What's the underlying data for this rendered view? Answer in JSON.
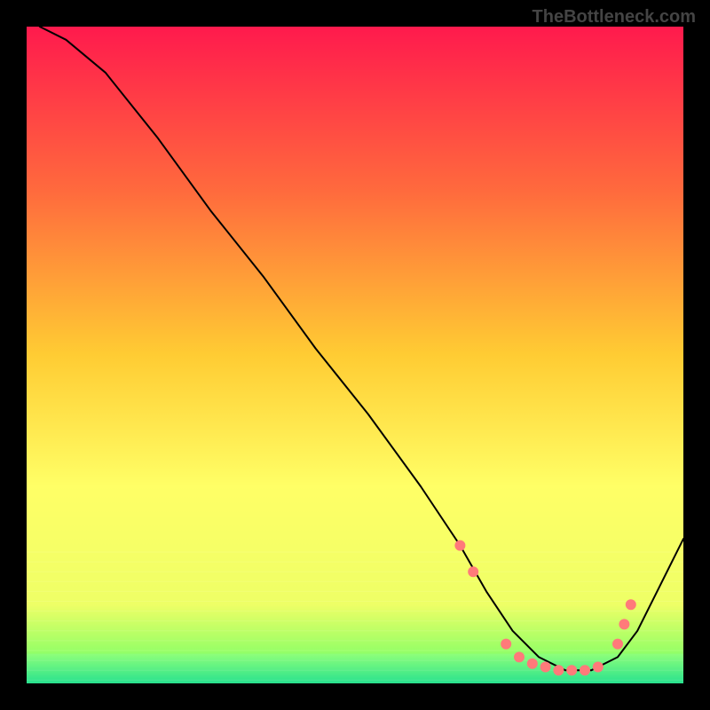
{
  "watermark": "TheBottleneck.com",
  "chart_data": {
    "type": "line",
    "title": "",
    "xlabel": "",
    "ylabel": "",
    "xlim": [
      0,
      100
    ],
    "ylim": [
      0,
      100
    ],
    "grid": false,
    "legend": false,
    "background": {
      "type": "vertical-gradient",
      "stops": [
        {
          "pos": 0.0,
          "color": "#ff1a4d"
        },
        {
          "pos": 0.25,
          "color": "#ff6a3d"
        },
        {
          "pos": 0.5,
          "color": "#ffcc33"
        },
        {
          "pos": 0.7,
          "color": "#ffff66"
        },
        {
          "pos": 0.88,
          "color": "#eeff66"
        },
        {
          "pos": 0.95,
          "color": "#99ff66"
        },
        {
          "pos": 1.0,
          "color": "#33ee88"
        }
      ]
    },
    "green_band": {
      "top_fraction": 0.955,
      "color_top": "#8eff7a",
      "color_bottom": "#28e28e"
    },
    "series": [
      {
        "name": "curve",
        "color": "#000000",
        "width": 2,
        "x": [
          2,
          6,
          12,
          20,
          28,
          36,
          44,
          52,
          60,
          66,
          70,
          74,
          78,
          82,
          86,
          90,
          93,
          96,
          100
        ],
        "y": [
          100,
          98,
          93,
          83,
          72,
          62,
          51,
          41,
          30,
          21,
          14,
          8,
          4,
          2,
          2,
          4,
          8,
          14,
          22
        ]
      }
    ],
    "markers": {
      "color": "#ff7a7a",
      "radius": 6,
      "points": [
        {
          "x": 66,
          "y": 21
        },
        {
          "x": 68,
          "y": 17
        },
        {
          "x": 73,
          "y": 6
        },
        {
          "x": 75,
          "y": 4
        },
        {
          "x": 77,
          "y": 3
        },
        {
          "x": 79,
          "y": 2.5
        },
        {
          "x": 81,
          "y": 2
        },
        {
          "x": 83,
          "y": 2
        },
        {
          "x": 85,
          "y": 2
        },
        {
          "x": 87,
          "y": 2.5
        },
        {
          "x": 90,
          "y": 6
        },
        {
          "x": 91,
          "y": 9
        },
        {
          "x": 92,
          "y": 12
        }
      ]
    }
  }
}
